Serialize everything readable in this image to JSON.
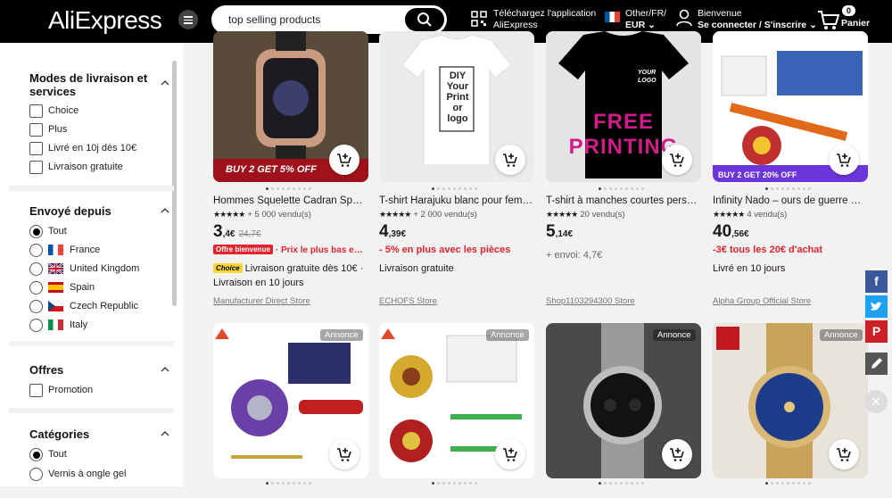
{
  "header": {
    "logo": "AliExpress",
    "search_value": "top selling products",
    "app_download_line1": "Téléchargez l'application",
    "app_download_line2": "AliExpress",
    "lang_line1": "Other/FR/",
    "lang_line2": "EUR",
    "account_line1": "Bienvenue",
    "account_line2": "Se connecter / S'inscrire",
    "cart_count": "0",
    "cart_label": "Panier"
  },
  "sidebar": {
    "delivery": {
      "title": "Modes de livraison et services",
      "options": [
        "Choice",
        "Plus",
        "Livré en 10j dès 10€",
        "Livraison gratuite"
      ]
    },
    "ships_from": {
      "title": "Envoyé depuis",
      "options": [
        "Tout",
        "France",
        "United Kingdom",
        "Spain",
        "Czech Republic",
        "Italy"
      ],
      "selected": "Tout"
    },
    "offers": {
      "title": "Offres",
      "options": [
        "Promotion"
      ]
    },
    "categories": {
      "title": "Catégories",
      "options": [
        "Tout",
        "Vernis à ongle gel"
      ],
      "selected": "Tout"
    }
  },
  "products": [
    {
      "title": "Hommes Squelette Cadran Sport Lu…",
      "rating_text": "+ 5 000 vendu(s)",
      "price_int": "3",
      "price_dec": ",4€",
      "price_old": "24,7€",
      "badge": "Offre bienvenue",
      "promo": "· Prix le plus bas e…",
      "choice_tag": "Choice",
      "shipping": "Livraison gratuite dès 10€ ·",
      "shipping2": "Livraison en 10 jours",
      "store": "Manufacturer Direct Store",
      "image_banner": "BUY 2 GET 5% OFF"
    },
    {
      "title": "T-shirt Harajuku blanc pour femmes…",
      "rating_text": "+ 2 000 vendu(s)",
      "price_int": "4",
      "price_dec": ",39€",
      "promo": "- 5% en plus avec les pièces",
      "shipping": "Livraison gratuite",
      "store": "ECHOFS Store",
      "image_text": "DIY Your Print or logo"
    },
    {
      "title": "T-shirt à manches courtes personna…",
      "rating_text": "20 vendu(s)",
      "price_int": "5",
      "price_dec": ",14€",
      "shipping": "+ envoi: 4,7€",
      "store": "Shop1103294300 Store",
      "image_text": "FREE PRINTING",
      "image_logo": "YOUR LOGO"
    },
    {
      "title": "Infinity Nado – ours de guerre en al…",
      "rating_text": "4 vendu(s)",
      "price_int": "40",
      "price_dec": ",56€",
      "promo": "-3€ tous les 20€ d'achat",
      "shipping": "Livré en 10 jours",
      "store": "Alpha Group Official Store",
      "image_banner": "BUY 2 GET 20% OFF"
    }
  ],
  "ad_label": "Annonce",
  "colors": {
    "header_bg": "#000000",
    "accent_red": "#e3232d",
    "choice_yellow": "#fdd835",
    "facebook": "#3b5998",
    "twitter": "#1da1f2",
    "pinterest": "#cb2027"
  }
}
